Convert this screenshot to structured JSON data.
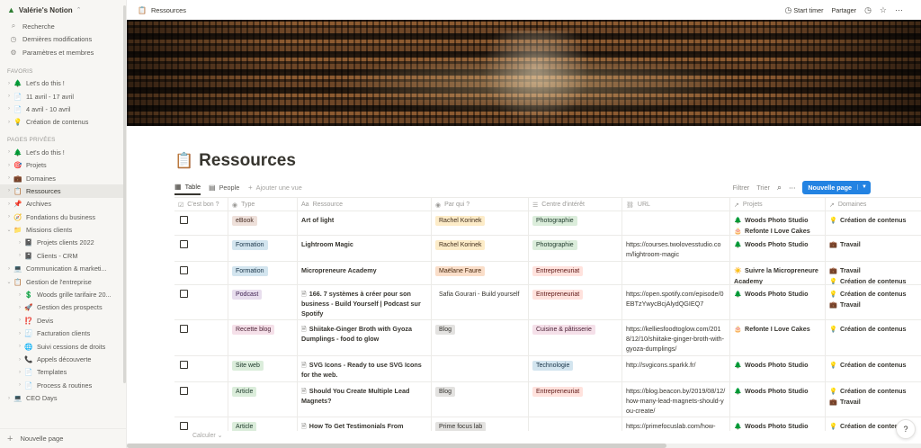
{
  "workspace": {
    "name": "Valérie's Notion",
    "icon": "tree-icon"
  },
  "sidebar_nav": [
    {
      "label": "Recherche",
      "icon": "search-icon",
      "glyph": "⌕"
    },
    {
      "label": "Dernières modifications",
      "icon": "clock-icon",
      "glyph": "◷"
    },
    {
      "label": "Paramètres et membres",
      "icon": "gear-icon",
      "glyph": "⚙"
    }
  ],
  "favoris": {
    "title": "FAVORIS",
    "items": [
      {
        "label": "Let's do this !",
        "emoji": "🌲"
      },
      {
        "label": "11 avril - 17 avril",
        "emoji": "📄"
      },
      {
        "label": "4 avril - 10 avril",
        "emoji": "📄"
      },
      {
        "label": "Création de contenus",
        "emoji": "💡"
      }
    ]
  },
  "pages_privees": {
    "title": "PAGES PRIVÉES",
    "items": [
      {
        "label": "Let's do this !",
        "emoji": "🌲",
        "level": 0
      },
      {
        "label": "Projets",
        "emoji": "🎯",
        "level": 0
      },
      {
        "label": "Domaines",
        "emoji": "💼",
        "level": 0
      },
      {
        "label": "Ressources",
        "emoji": "📋",
        "level": 0,
        "active": true
      },
      {
        "label": "Archives",
        "emoji": "📌",
        "level": 0
      },
      {
        "label": "Fondations du business",
        "emoji": "🧭",
        "level": 0
      },
      {
        "label": "Missions clients",
        "emoji": "📁",
        "level": 0,
        "open": true
      },
      {
        "label": "Projets clients 2022",
        "emoji": "📓",
        "level": 1
      },
      {
        "label": "Clients - CRM",
        "emoji": "📓",
        "level": 1
      },
      {
        "label": "Communication & marketi...",
        "emoji": "💻",
        "level": 0
      },
      {
        "label": "Gestion de l'entreprise",
        "emoji": "📋",
        "level": 0,
        "open": true
      },
      {
        "label": "Woods grille tarifaire 20...",
        "emoji": "💲",
        "level": 1
      },
      {
        "label": "Gestion des prospects",
        "emoji": "🚀",
        "level": 1
      },
      {
        "label": "Devis",
        "emoji": "⁉️",
        "level": 1
      },
      {
        "label": "Facturation clients",
        "emoji": "🧾",
        "level": 1
      },
      {
        "label": "Suivi cessions de droits",
        "emoji": "🌐",
        "level": 1
      },
      {
        "label": "Appels découverte",
        "emoji": "📞",
        "level": 1
      },
      {
        "label": "Templates",
        "emoji": "📄",
        "level": 1
      },
      {
        "label": "Process & routines",
        "emoji": "📄",
        "level": 1
      },
      {
        "label": "CEO Days",
        "emoji": "💻",
        "level": 0
      }
    ]
  },
  "new_page_label": "Nouvelle page",
  "topbar": {
    "breadcrumb": "Ressources",
    "start_timer": "Start timer",
    "share": "Partager"
  },
  "page": {
    "title": "Ressources",
    "icon": "clipboard-icon"
  },
  "views": [
    {
      "label": "Table",
      "selected": true
    },
    {
      "label": "People",
      "selected": false
    },
    {
      "label": "Ajouter une vue",
      "selected": false
    }
  ],
  "toolbar": {
    "filter": "Filtrer",
    "sort": "Trier",
    "new_button": "Nouvelle page"
  },
  "columns": [
    {
      "label": "C'est bon ?",
      "icon": "☑"
    },
    {
      "label": "Type",
      "icon": "◉"
    },
    {
      "label": "Ressource",
      "icon": "Aa"
    },
    {
      "label": "Par qui ?",
      "icon": "◉"
    },
    {
      "label": "Centre d'intérêt",
      "icon": "☰"
    },
    {
      "label": "URL",
      "icon": "⛓"
    },
    {
      "label": "Projets",
      "icon": "↗"
    },
    {
      "label": "Domaines",
      "icon": "↗"
    }
  ],
  "rows": [
    {
      "type": "eBook",
      "type_color": "brown",
      "name": "Art of light",
      "doc": false,
      "by": "Rachel Korinek",
      "by_color": "yellow",
      "interest": "Photographie",
      "interest_color": "green",
      "url": "",
      "projects": [
        {
          "emoji": "🌲",
          "label": "Woods Photo Studio"
        },
        {
          "emoji": "🎂",
          "label": "Refonte I Love Cakes"
        }
      ],
      "domains": [
        {
          "emoji": "💡",
          "label": "Création de contenus"
        }
      ]
    },
    {
      "type": "Formation",
      "type_color": "blue",
      "name": "Lightroom Magic",
      "doc": false,
      "by": "Rachel Korinek",
      "by_color": "yellow",
      "interest": "Photographie",
      "interest_color": "green",
      "url": "https://courses.twolovesstudio.com/lightroom-magic",
      "projects": [
        {
          "emoji": "🌲",
          "label": "Woods Photo Studio"
        }
      ],
      "domains": [
        {
          "emoji": "💼",
          "label": "Travail"
        }
      ]
    },
    {
      "type": "Formation",
      "type_color": "blue",
      "name": "Micropreneure Academy",
      "doc": false,
      "by": "Maëlane Faure",
      "by_color": "orange",
      "interest": "Entrepreneuriat",
      "interest_color": "red",
      "url": "",
      "projects": [
        {
          "emoji": "☀️",
          "label": "Suivre la Micropreneure Academy"
        }
      ],
      "domains": [
        {
          "emoji": "💼",
          "label": "Travail"
        },
        {
          "emoji": "💡",
          "label": "Création de contenus"
        }
      ]
    },
    {
      "type": "Podcast",
      "type_color": "purple",
      "name": "166. 7 systèmes à créer pour son business - Build Yourself | Podcast sur Spotify",
      "doc": true,
      "by": "Safia Gourari - Build yourself",
      "by_color": "none",
      "interest": "Entrepreneuriat",
      "interest_color": "red",
      "url": "https://open.spotify.com/episode/0EBTzYwycBcjAlydQGIEQ7",
      "projects": [
        {
          "emoji": "🌲",
          "label": "Woods Photo Studio"
        }
      ],
      "domains": [
        {
          "emoji": "💡",
          "label": "Création de contenus"
        },
        {
          "emoji": "💼",
          "label": "Travail"
        }
      ]
    },
    {
      "type": "Recette blog",
      "type_color": "pink",
      "name": "Shiitake-Ginger Broth with Gyoza Dumplings - food to glow",
      "doc": true,
      "by": "Blog",
      "by_color": "gray",
      "interest": "Cuisine & pâtisserie",
      "interest_color": "pink",
      "url": "https://kelliesfoodtoglow.com/2018/12/10/shiitake-ginger-broth-with-gyoza-dumplings/",
      "projects": [
        {
          "emoji": "🎂",
          "label": "Refonte I Love Cakes"
        }
      ],
      "domains": [
        {
          "emoji": "💡",
          "label": "Création de contenus"
        }
      ]
    },
    {
      "type": "Site web",
      "type_color": "green",
      "name": "SVG Icons - Ready to use SVG Icons for the web.",
      "doc": true,
      "by": "",
      "by_color": "none",
      "interest": "Technologie",
      "interest_color": "blue",
      "url": "http://svgicons.sparkk.fr/",
      "projects": [
        {
          "emoji": "🌲",
          "label": "Woods Photo Studio"
        }
      ],
      "domains": [
        {
          "emoji": "💡",
          "label": "Création de contenus"
        }
      ]
    },
    {
      "type": "Article",
      "type_color": "green",
      "name": "Should You Create Multiple Lead Magnets?",
      "doc": true,
      "by": "Blog",
      "by_color": "gray",
      "interest": "Entrepreneuriat",
      "interest_color": "red",
      "url": "https://blog.beacon.by/2019/08/12/how-many-lead-magnets-should-you-create/",
      "projects": [
        {
          "emoji": "🌲",
          "label": "Woods Photo Studio"
        }
      ],
      "domains": [
        {
          "emoji": "💡",
          "label": "Création de contenus"
        },
        {
          "emoji": "💼",
          "label": "Travail"
        }
      ]
    },
    {
      "type": "Article",
      "type_color": "green",
      "name": "How To Get Testimonials From",
      "doc": true,
      "by": "Prime focus lab",
      "by_color": "gray",
      "interest": "",
      "interest_color": "none",
      "url": "https://primefocuslab.com/how-",
      "projects": [
        {
          "emoji": "🌲",
          "label": "Woods Photo Studio"
        }
      ],
      "domains": [
        {
          "emoji": "💡",
          "label": "Création de contenus"
        }
      ]
    }
  ],
  "calc_label": "Calculer",
  "help_label": "?"
}
